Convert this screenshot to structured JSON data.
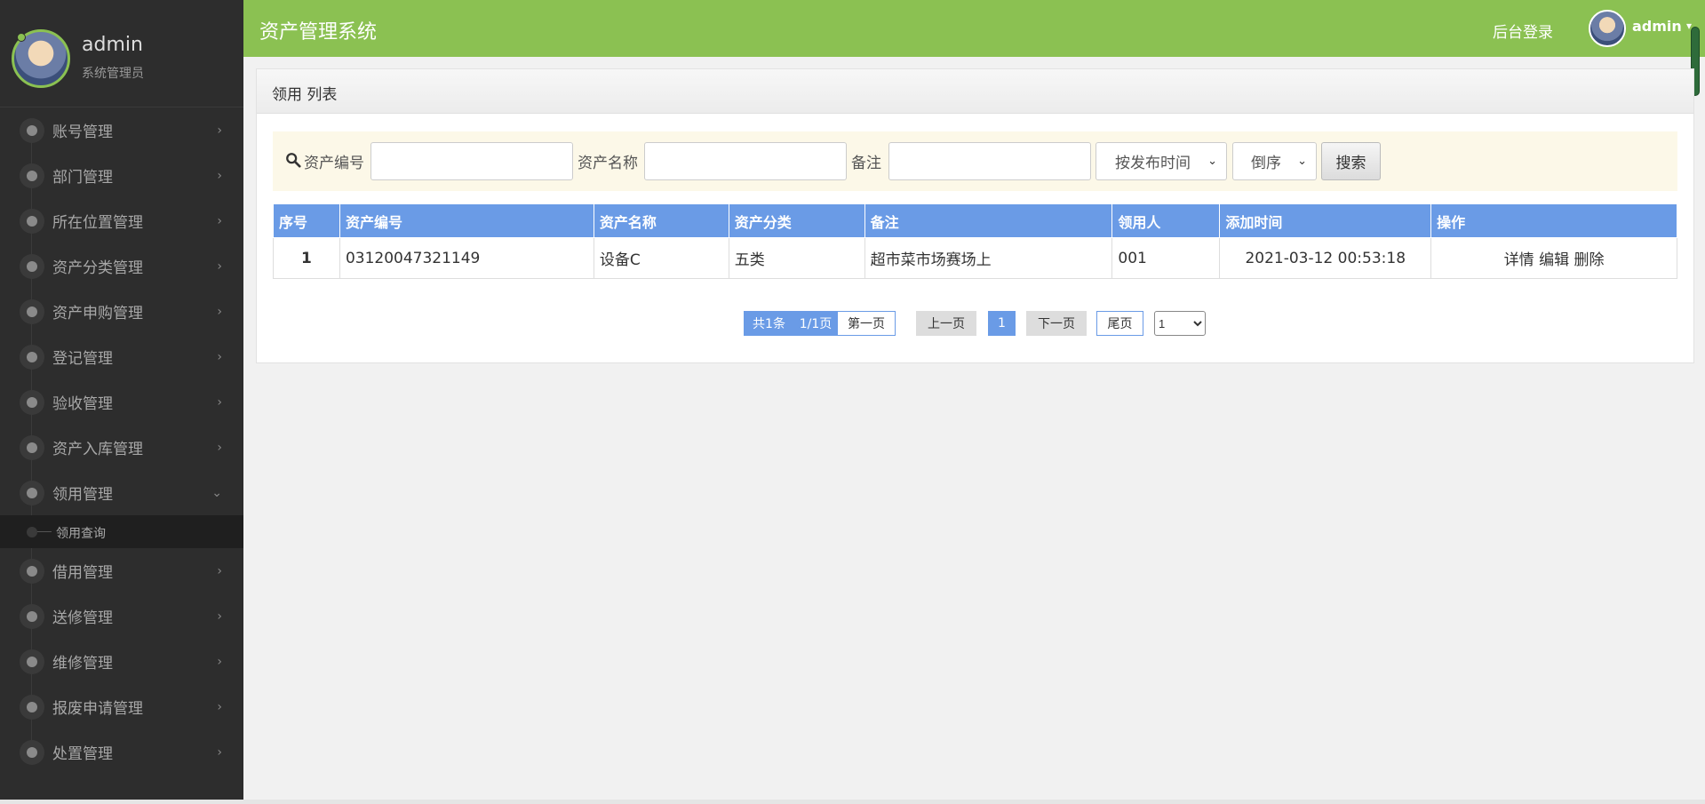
{
  "sidebar": {
    "user_name": "admin",
    "user_role": "系统管理员",
    "items": [
      {
        "label": "账号管理",
        "arrow": "›"
      },
      {
        "label": "部门管理",
        "arrow": "›"
      },
      {
        "label": "所在位置管理",
        "arrow": "›"
      },
      {
        "label": "资产分类管理",
        "arrow": "›"
      },
      {
        "label": "资产申购管理",
        "arrow": "›"
      },
      {
        "label": "登记管理",
        "arrow": "›"
      },
      {
        "label": "验收管理",
        "arrow": "›"
      },
      {
        "label": "资产入库管理",
        "arrow": "›"
      },
      {
        "label": "领用管理",
        "arrow": "⌄"
      },
      {
        "label": "借用管理",
        "arrow": "›"
      },
      {
        "label": "送修管理",
        "arrow": "›"
      },
      {
        "label": "维修管理",
        "arrow": "›"
      },
      {
        "label": "报废申请管理",
        "arrow": "›"
      },
      {
        "label": "处置管理",
        "arrow": "›"
      }
    ],
    "submenu_label": "领用查询"
  },
  "header": {
    "title": "资产管理系统",
    "login_link": "后台登录",
    "user_name": "admin",
    "caret": "▾"
  },
  "panel": {
    "title": "领用 列表"
  },
  "search": {
    "label_code": "资产编号",
    "label_name": "资产名称",
    "label_note": "备注",
    "sort_field": "按发布时间",
    "sort_order": "倒序",
    "button": "搜索",
    "chevron": "⌄"
  },
  "table": {
    "headers": [
      "序号",
      "资产编号",
      "资产名称",
      "资产分类",
      "备注",
      "领用人",
      "添加时间",
      "操作"
    ],
    "rows": [
      {
        "index": "1",
        "code": "03120047321149",
        "name": "设备C",
        "category": "五类",
        "note": "超市菜市场赛场上",
        "user": "001",
        "time": "2021-03-12 00:53:18",
        "act_detail": "详情",
        "act_edit": "编辑",
        "act_delete": "删除"
      }
    ]
  },
  "pager": {
    "total": "共1条",
    "pages": "1/1页",
    "first": "第一页",
    "prev": "上一页",
    "current": "1",
    "next": "下一页",
    "last": "尾页",
    "jump_value": "1"
  },
  "colors": {
    "header_green": "#8bc152",
    "table_blue": "#6a9be6",
    "sidebar_bg": "#2d2d2d"
  }
}
